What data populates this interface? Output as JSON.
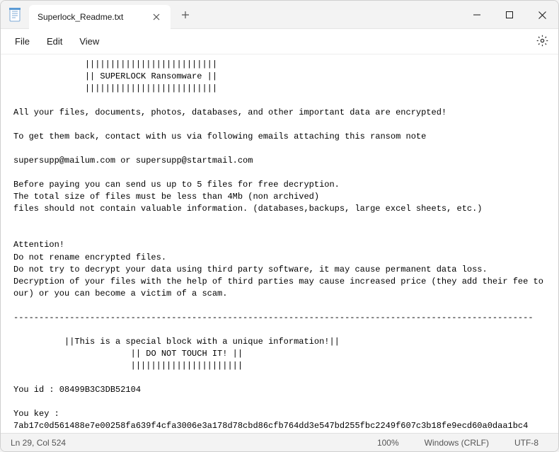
{
  "tab": {
    "title": "Superlock_Readme.txt"
  },
  "menu": {
    "file": "File",
    "edit": "Edit",
    "view": "View"
  },
  "content": {
    "text": "              ||||||||||||||||||||||||||\n              || SUPERLOCK Ransomware ||\n              ||||||||||||||||||||||||||\n\nAll your files, documents, photos, databases, and other important data are encrypted!\n\nTo get them back, contact with us via following emails attaching this ransom note\n\nsupersupp@mailum.com or supersupp@startmail.com\n\nBefore paying you can send us up to 5 files for free decryption.\nThe total size of files must be less than 4Mb (non archived)\nfiles should not contain valuable information. (databases,backups, large excel sheets, etc.)\n\n\nAttention!\nDo not rename encrypted files.\nDo not try to decrypt your data using third party software, it may cause permanent data loss.\nDecryption of your files with the help of third parties may cause increased price (they add their fee to our) or you can become a victim of a scam.\n\n------------------------------------------------------------------------------------------------------\n\n          ||This is a special block with a unique information!||\n                       || DO NOT TOUCH IT! ||\n                       ||||||||||||||||||||||\n\nYou id : 08499B3C3DB52104\n\nYou key : 7ab17c0d561488e7e00258fa639f4cfa3006e3a178d78cbd86cfb764dd3e547bd255fbc2249f607c3b18fe9ecd60a0daa1bc4"
  },
  "status": {
    "position": "Ln 29, Col 524",
    "zoom": "100%",
    "line_ending": "Windows (CRLF)",
    "encoding": "UTF-8"
  }
}
